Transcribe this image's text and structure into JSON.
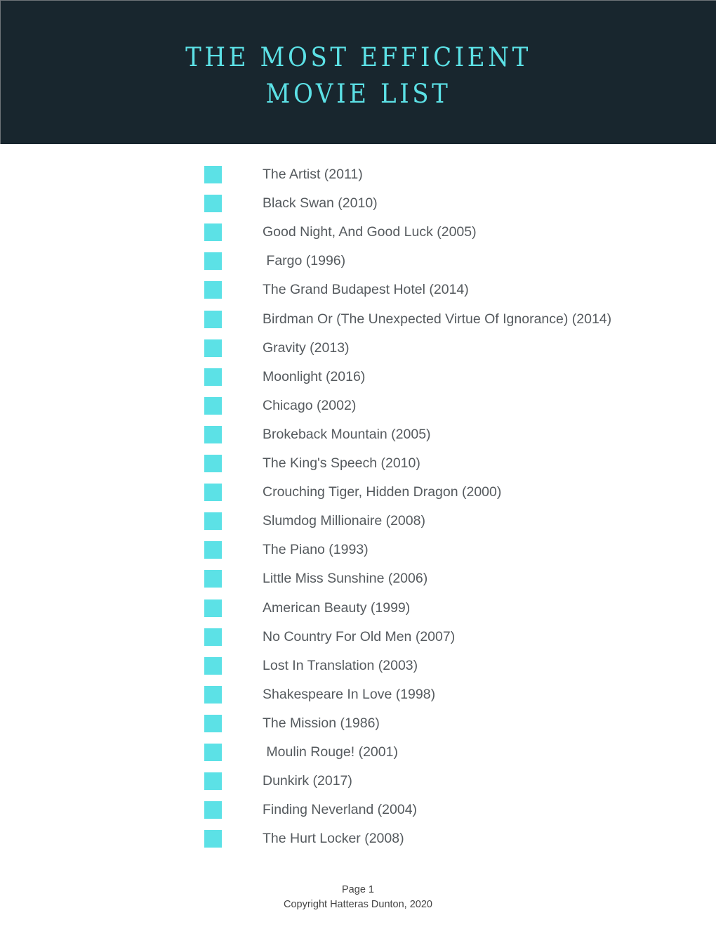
{
  "header": {
    "title_line1": "THE MOST EFFICIENT",
    "title_line2": "MOVIE LIST"
  },
  "colors": {
    "header_bg": "#18262e",
    "accent": "#5ce1e6",
    "text": "#555a5e"
  },
  "checkbox_icon": "square-checkbox-icon",
  "movies": [
    {
      "label": "The Artist (2011)",
      "checked": false
    },
    {
      "label": "Black Swan (2010)",
      "checked": false
    },
    {
      "label": "Good Night, And Good Luck (2005)",
      "checked": false
    },
    {
      "label": " Fargo (1996)",
      "checked": false
    },
    {
      "label": "The Grand Budapest Hotel (2014)",
      "checked": false
    },
    {
      "label": "Birdman Or (The Unexpected Virtue Of Ignorance) (2014)",
      "checked": false
    },
    {
      "label": "Gravity (2013)",
      "checked": false
    },
    {
      "label": "Moonlight (2016)",
      "checked": false
    },
    {
      "label": "Chicago (2002)",
      "checked": false
    },
    {
      "label": "Brokeback Mountain (2005)",
      "checked": false
    },
    {
      "label": "The King's Speech (2010)",
      "checked": false
    },
    {
      "label": "Crouching Tiger, Hidden Dragon (2000)",
      "checked": false
    },
    {
      "label": "Slumdog Millionaire (2008)",
      "checked": false
    },
    {
      "label": "The Piano (1993)",
      "checked": false
    },
    {
      "label": "Little Miss Sunshine (2006)",
      "checked": false
    },
    {
      "label": "American Beauty (1999)",
      "checked": false
    },
    {
      "label": "No Country For Old Men (2007)",
      "checked": false
    },
    {
      "label": "Lost In Translation (2003)",
      "checked": false
    },
    {
      "label": "Shakespeare In Love (1998)",
      "checked": false
    },
    {
      "label": "The Mission (1986)",
      "checked": false
    },
    {
      "label": " Moulin Rouge! (2001)",
      "checked": false
    },
    {
      "label": "Dunkirk (2017)",
      "checked": false
    },
    {
      "label": "Finding Neverland (2004)",
      "checked": false
    },
    {
      "label": "The Hurt Locker (2008)",
      "checked": false
    }
  ],
  "footer": {
    "page": "Page 1",
    "copyright": "Copyright Hatteras Dunton, 2020"
  }
}
